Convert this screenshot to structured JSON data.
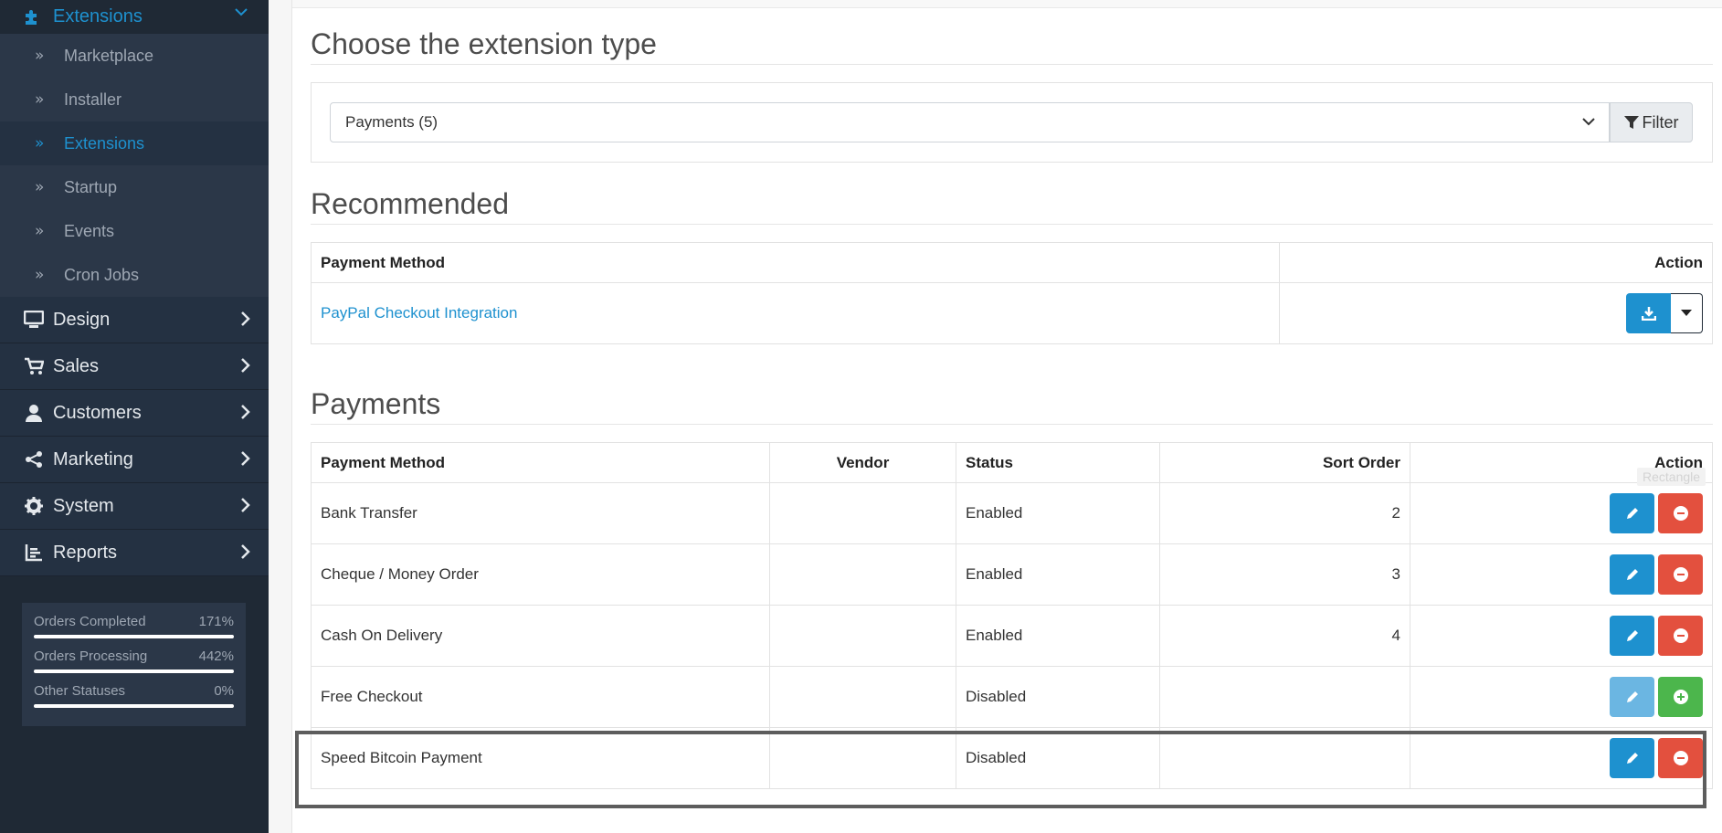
{
  "sidebar": {
    "active_section": {
      "label": "Extensions",
      "icon": "puzzle-icon"
    },
    "sub_items": [
      {
        "label": "Marketplace",
        "active": false
      },
      {
        "label": "Installer",
        "active": false
      },
      {
        "label": "Extensions",
        "active": true
      },
      {
        "label": "Startup",
        "active": false
      },
      {
        "label": "Events",
        "active": false
      },
      {
        "label": "Cron Jobs",
        "active": false
      }
    ],
    "main_items": [
      {
        "label": "Design",
        "icon": "monitor-icon"
      },
      {
        "label": "Sales",
        "icon": "cart-icon"
      },
      {
        "label": "Customers",
        "icon": "user-icon"
      },
      {
        "label": "Marketing",
        "icon": "share-icon"
      },
      {
        "label": "System",
        "icon": "gear-icon"
      },
      {
        "label": "Reports",
        "icon": "bar-chart-icon"
      }
    ],
    "stats": [
      {
        "label": "Orders Completed",
        "value": "171%",
        "fill_percent": 100
      },
      {
        "label": "Orders Processing",
        "value": "442%",
        "fill_percent": 100
      },
      {
        "label": "Other Statuses",
        "value": "0%",
        "fill_percent": 100
      }
    ]
  },
  "main": {
    "choose_title": "Choose the extension type",
    "type_select": {
      "value": "Payments (5)"
    },
    "filter_label": "Filter",
    "recommended": {
      "title": "Recommended",
      "headers": {
        "method": "Payment Method",
        "action": "Action"
      },
      "rows": [
        {
          "method": "PayPal Checkout Integration"
        }
      ]
    },
    "payments": {
      "title": "Payments",
      "headers": {
        "method": "Payment Method",
        "vendor": "Vendor",
        "status": "Status",
        "sort": "Sort Order",
        "action": "Action"
      },
      "rows": [
        {
          "method": "Bank Transfer",
          "vendor": "",
          "status": "Enabled",
          "sort": "2",
          "installed": true
        },
        {
          "method": "Cheque / Money Order",
          "vendor": "",
          "status": "Enabled",
          "sort": "3",
          "installed": true
        },
        {
          "method": "Cash On Delivery",
          "vendor": "",
          "status": "Enabled",
          "sort": "4",
          "installed": true
        },
        {
          "method": "Free Checkout",
          "vendor": "",
          "status": "Disabled",
          "sort": "",
          "installed": false
        },
        {
          "method": "Speed Bitcoin Payment",
          "vendor": "",
          "status": "Disabled",
          "sort": "",
          "installed": true
        }
      ]
    },
    "tooltip": "Rectangle"
  },
  "colors": {
    "sidebar_bg": "#1f2935",
    "accent": "#1e91cf",
    "danger": "#e3503e",
    "success": "#4cb64c"
  }
}
